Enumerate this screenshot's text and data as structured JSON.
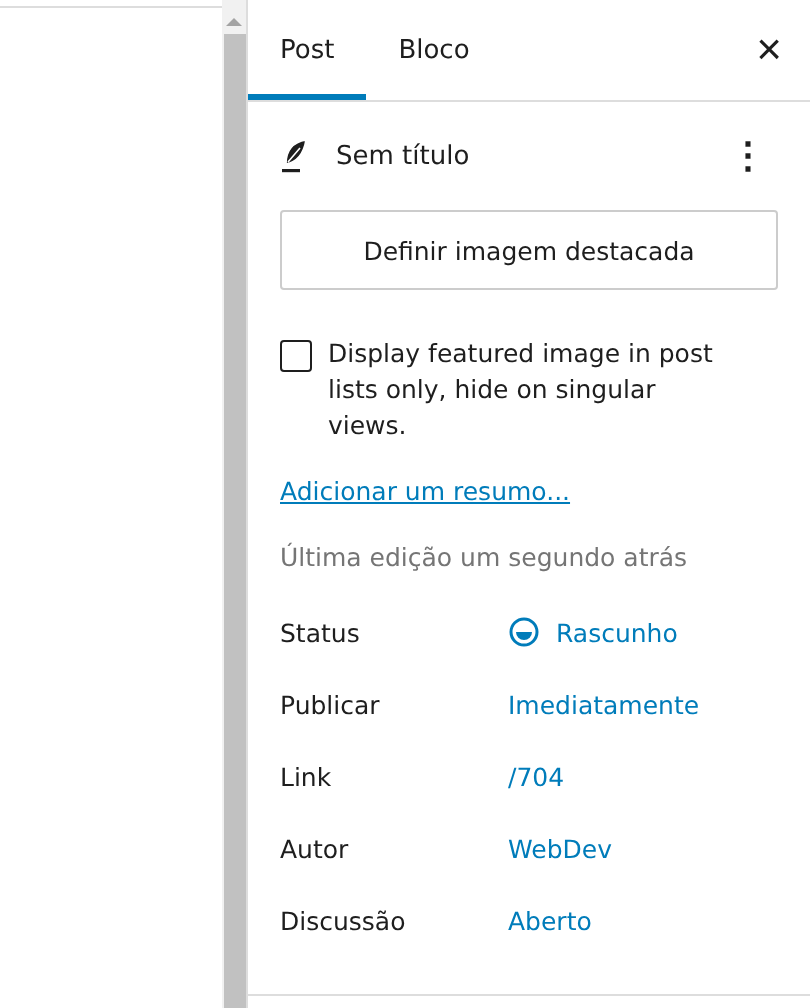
{
  "tabs": [
    {
      "label": "Post",
      "selected": true
    },
    {
      "label": "Bloco",
      "selected": false
    }
  ],
  "close": "×",
  "post": {
    "title": "Sem título",
    "menu": "⋮"
  },
  "featured_button": "Definir imagem destacada",
  "featured_option": {
    "label": "Display featured image in post lists only, hide on singular views.",
    "checked": false
  },
  "excerpt_link": "Adicionar um resumo...",
  "last_edit": "Última edição um segundo atrás",
  "settings": [
    {
      "label": "Status",
      "value": "Rascunho",
      "kind": "status"
    },
    {
      "label": "Publicar",
      "value": "Imediatamente",
      "kind": "link"
    },
    {
      "label": "Link",
      "value": "/704",
      "kind": "link"
    },
    {
      "label": "Autor",
      "value": "WebDev",
      "kind": "link"
    },
    {
      "label": "Discussão",
      "value": "Aberto",
      "kind": "link"
    }
  ]
}
